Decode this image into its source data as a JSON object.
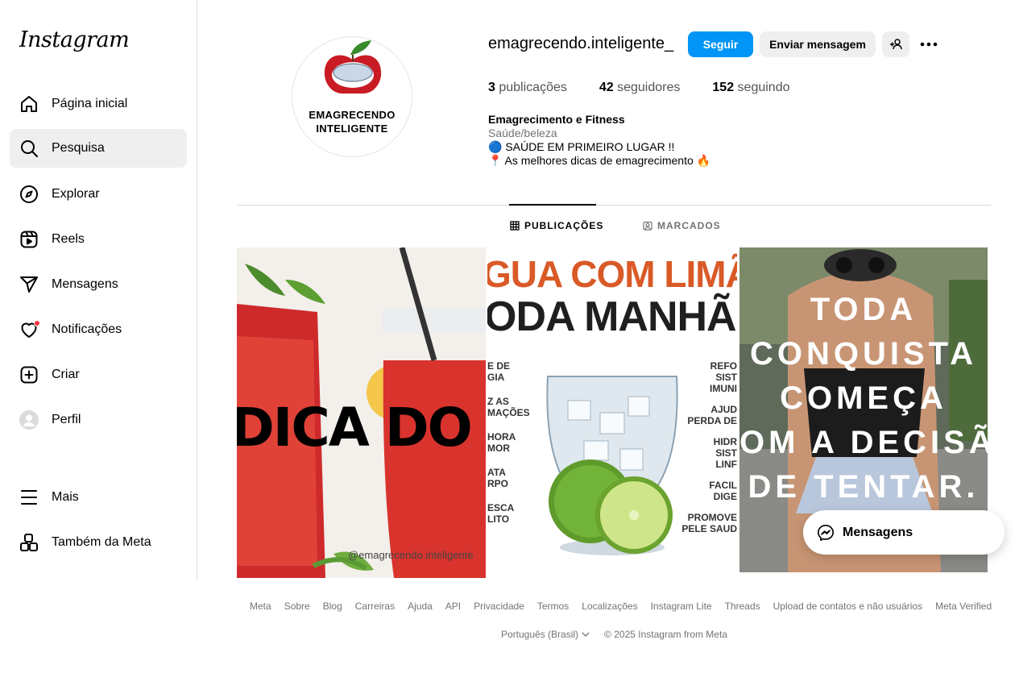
{
  "app": {
    "logo": "Instagram"
  },
  "sidebar": {
    "items": [
      {
        "label": "Página inicial",
        "icon": "home-icon"
      },
      {
        "label": "Pesquisa",
        "icon": "search-icon",
        "active": true
      },
      {
        "label": "Explorar",
        "icon": "compass-icon"
      },
      {
        "label": "Reels",
        "icon": "reels-icon"
      },
      {
        "label": "Mensagens",
        "icon": "send-icon"
      },
      {
        "label": "Notificações",
        "icon": "heart-icon"
      },
      {
        "label": "Criar",
        "icon": "plus-icon"
      },
      {
        "label": "Perfil",
        "icon": "avatar-icon"
      }
    ],
    "more": "Mais",
    "meta": "Também da Meta"
  },
  "profile": {
    "avatar_text_line1": "EMAGRECENDO",
    "avatar_text_line2": "INTELIGENTE",
    "username": "emagrecendo.inteligente_",
    "follow_label": "Seguir",
    "message_label": "Enviar mensagem",
    "stats": {
      "posts_count": "3",
      "posts_label": "publicações",
      "followers_count": "42",
      "followers_label": "seguidores",
      "following_count": "152",
      "following_label": "seguindo"
    },
    "bio": {
      "name": "Emagrecimento e Fitness",
      "category": "Saúde/beleza",
      "line1": "🔵 SAÚDE EM PRIMEIRO LUGAR !!",
      "line2": "📍 As melhores dicas de emagrecimento 🔥"
    }
  },
  "tabs": {
    "posts": "PUBLICAÇÕES",
    "tagged": "MARCADOS"
  },
  "posts": {
    "p1": {
      "text": "DICA DO DIA",
      "watermark": "@emagrecendo.inteligente"
    },
    "p2": {
      "title1": "GUA COM LIMÃ",
      "title2": "ODA MANHÃ",
      "left": [
        "E DE",
        "GIA",
        "Z AS",
        "MAÇÕES",
        "HORA",
        "MOR",
        "ATA",
        "RPO",
        "ESCA",
        "LITO"
      ],
      "right": [
        "REFO",
        "SIST",
        "IMUNI",
        "AJUD",
        "PERDA DE",
        "HIDR",
        "SIST",
        "LINF",
        "FACIL",
        "DIGE",
        "PROMOVE",
        "PELE SAUD"
      ]
    },
    "p3": {
      "lines": [
        "TODA",
        "CONQUISTA",
        "COMEÇA",
        "OM A DECISÃ",
        "DE TENTAR."
      ]
    }
  },
  "messenger": {
    "label": "Mensagens"
  },
  "footer": {
    "links": [
      "Meta",
      "Sobre",
      "Blog",
      "Carreiras",
      "Ajuda",
      "API",
      "Privacidade",
      "Termos",
      "Localizações",
      "Instagram Lite",
      "Threads",
      "Upload de contatos e não usuários",
      "Meta Verified"
    ],
    "language": "Português (Brasil)",
    "copyright": "© 2025 Instagram from Meta"
  },
  "colors": {
    "accent": "#0095f6",
    "notification": "#ff3040",
    "muted": "#737373"
  }
}
